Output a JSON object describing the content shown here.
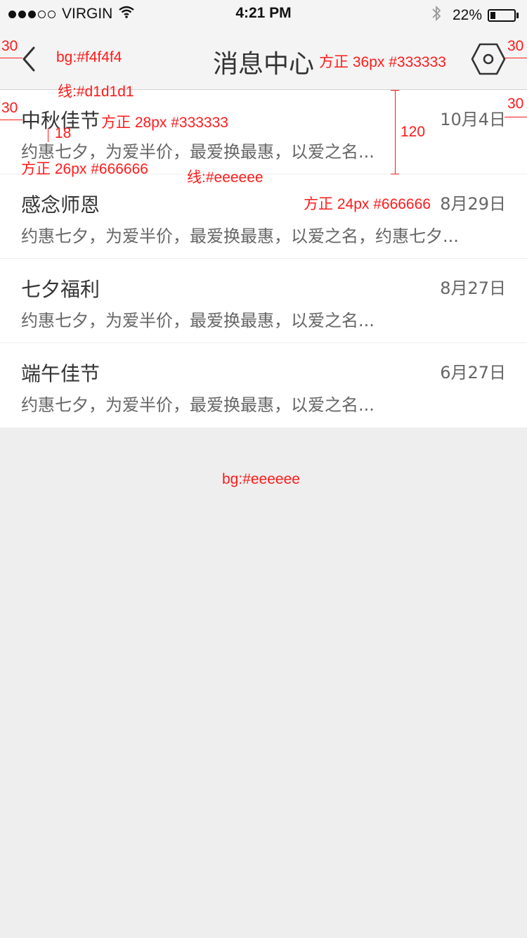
{
  "status_bar": {
    "carrier": "VIRGIN",
    "time": "4:21 PM",
    "battery_text": "22%",
    "battery_level": 0.22
  },
  "nav": {
    "title": "消息中心"
  },
  "messages": [
    {
      "title": "中秋佳节",
      "date": "10月4日",
      "preview": "约惠七夕，为爱半价，最爱换最惠，以爱之名..."
    },
    {
      "title": "感念师恩",
      "date": "8月29日",
      "preview": "约惠七夕，为爱半价，最爱换最惠，以爱之名，约惠七夕..."
    },
    {
      "title": "七夕福利",
      "date": "8月27日",
      "preview": "约惠七夕，为爱半价，最爱换最惠，以爱之名..."
    },
    {
      "title": "端午佳节",
      "date": "6月27日",
      "preview": "约惠七夕，为爱半价，最爱换最惠，以爱之名..."
    }
  ],
  "annotations": {
    "margin_left_nav": "30",
    "nav_bg": "bg:#f4f4f4",
    "title_font": "方正 36px #333333",
    "margin_right_nav": "30",
    "nav_line": "线:#d1d1d1",
    "margin_left_item": "30",
    "item_title_font": "方正 28px #333333",
    "margin_right_item": "30",
    "spacing": "18",
    "row_height": "120",
    "preview_font": "方正 26px #666666",
    "divider_line": "线:#eeeeee",
    "date_font": "方正 24px #666666",
    "page_bg": "bg:#eeeeee"
  },
  "colors": {
    "nav_bg": "#f4f4f4",
    "nav_line": "#d1d1d1",
    "page_bg": "#eeeeee",
    "title": "#333333",
    "secondary": "#666666",
    "annotation": "#ff1a1a"
  }
}
